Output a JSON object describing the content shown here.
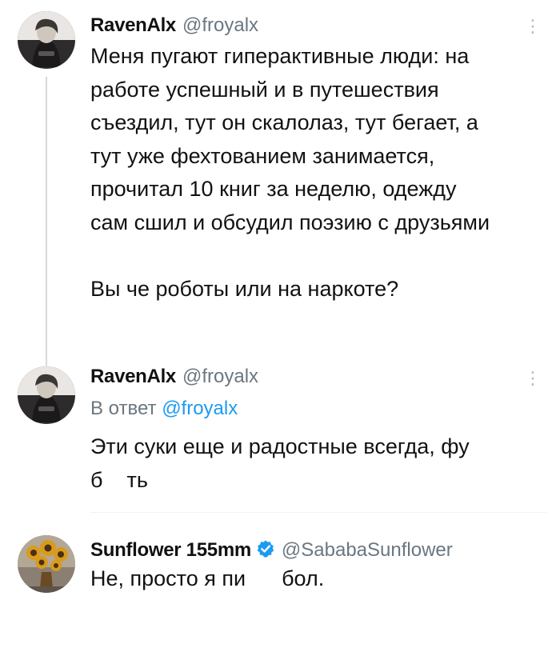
{
  "tweets": [
    {
      "display_name": "RavenAlx",
      "handle": "@froyalx",
      "more_icon": "⋮",
      "text": "Меня пугают гиперактивные люди: на\nработе успешный и в путешествия\nсъездил, тут он скалолаз, тут бегает, а\nтут уже фехтованием занимается,\nпрочитал 10 книг за неделю, одежду\nсам сшил и обсудил поэзию с друзьями\n\nВы че роботы или на наркоте?"
    },
    {
      "display_name": "RavenAlx",
      "handle": "@froyalx",
      "more_icon": "⋮",
      "reply_prefix": "В ответ",
      "reply_handle": "@froyalx",
      "text": "Эти суки еще и радостные всегда, фу\nб    ть"
    },
    {
      "display_name": "Sunflower 155mm",
      "verified_icon": "verified-badge-icon",
      "handle": "@SababaSunflower",
      "text": "Не, просто я пи      бол."
    }
  ],
  "colors": {
    "text": "#121212",
    "secondary": "#6b7780",
    "mention": "#1d9bf0",
    "verified": "#1d9bf0",
    "thread_line": "#d6d9dc"
  }
}
